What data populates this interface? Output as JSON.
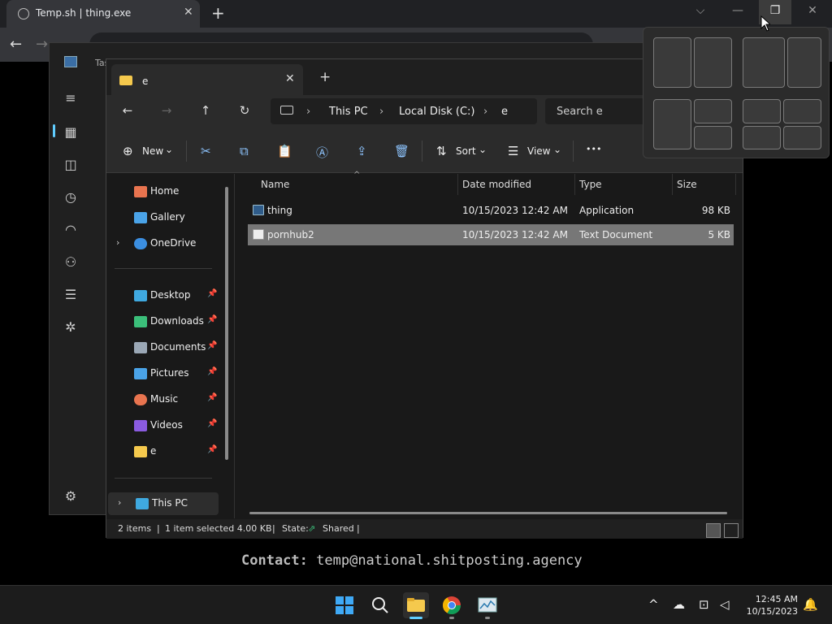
{
  "browser": {
    "tab_title": "Temp.sh | thing.exe",
    "tab_close": "✕",
    "new_tab": "+",
    "controls": {
      "dropdown": "⌵",
      "minimize": "—",
      "maximize": "❐",
      "close": "✕"
    },
    "back": "←",
    "forward": "→"
  },
  "task_manager": {
    "title": "Tas",
    "menu": "≡",
    "settings": "⚙"
  },
  "explorer": {
    "tab_title": "e",
    "tab_close": "✕",
    "new_tab": "+",
    "nav": {
      "back": "←",
      "forward": "→",
      "up": "↑",
      "refresh": "↻"
    },
    "breadcrumb": [
      "This PC",
      "Local Disk (C:)",
      "e"
    ],
    "breadcrumb_sep": "›",
    "search_placeholder": "Search e",
    "toolbar": {
      "new_label": "New",
      "sort_label": "Sort",
      "view_label": "View",
      "more": "•••",
      "icons": {
        "new": "⊕",
        "cut": "✂",
        "copy": "⧉",
        "paste": "📋",
        "rename": "Ⓐ",
        "share": "⇪",
        "delete": "🗑",
        "sort": "⇅",
        "view": "☰",
        "chevron": "⌄"
      }
    },
    "nav_pane": {
      "chevron": "›",
      "pin": "📌",
      "items": [
        {
          "label": "Home",
          "color": "#e8744f"
        },
        {
          "label": "Gallery",
          "color": "#4aa3e8"
        },
        {
          "label": "OneDrive",
          "color": "#3b8ee0"
        },
        {
          "label": "Desktop",
          "color": "#3fa9e0"
        },
        {
          "label": "Downloads",
          "color": "#3bbf7a"
        },
        {
          "label": "Documents",
          "color": "#9aa7b5"
        },
        {
          "label": "Pictures",
          "color": "#4aa3e8"
        },
        {
          "label": "Music",
          "color": "#e8744f"
        },
        {
          "label": "Videos",
          "color": "#8a5be0"
        },
        {
          "label": "e",
          "color": "#f5c94d"
        },
        {
          "label": "This PC",
          "color": "#3fa9e0"
        }
      ]
    },
    "columns": [
      "Name",
      "Date modified",
      "Type",
      "Size"
    ],
    "sort_indicator": "^",
    "files": [
      {
        "name": "thing",
        "date": "10/15/2023 12:42 AM",
        "type": "Application",
        "size": "98 KB"
      },
      {
        "name": "pornhub2",
        "date": "10/15/2023 12:42 AM",
        "type": "Text Document",
        "size": "5 KB"
      }
    ],
    "status": {
      "items": "2 items",
      "selected": "1 item selected  4.00 KB",
      "state_label": "State:",
      "state_value": "Shared",
      "sep": "|"
    }
  },
  "contact": {
    "label": "Contact:",
    "email": "temp@national.shitposting.agency"
  },
  "taskbar": {
    "tray_up": "^",
    "clock_time": "12:45 AM",
    "clock_date": "10/15/2023",
    "bell": "🔔"
  },
  "colors": {
    "accent": "#60cdff",
    "selected_row": "#777777",
    "folder": "#f5c94d"
  }
}
